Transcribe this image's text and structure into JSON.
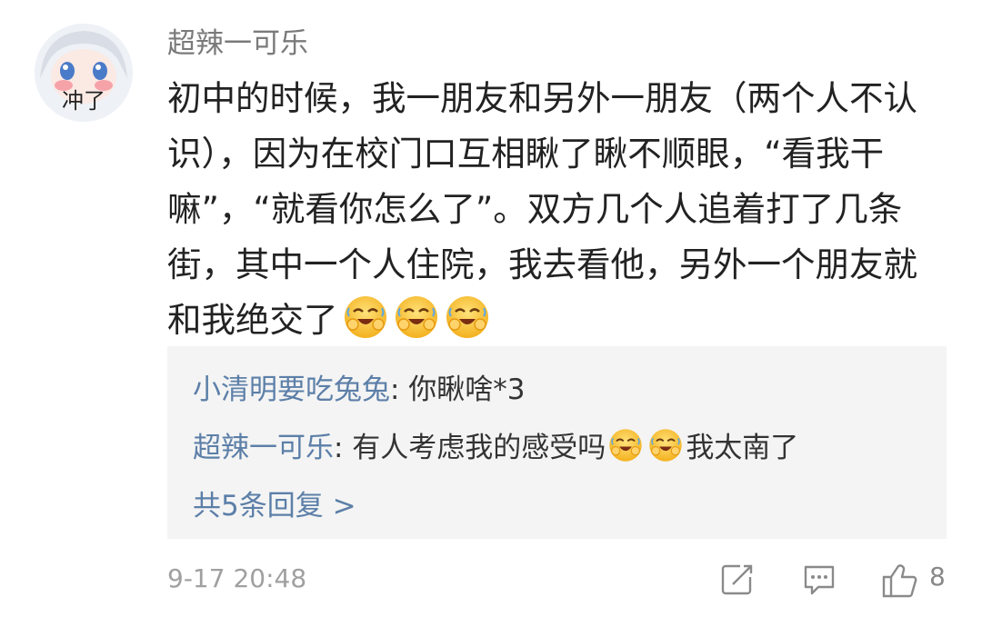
{
  "comment": {
    "avatar_text": "冲了",
    "username": "超辣一可乐",
    "lines": [
      "初中的时候，我一朋友和另外一朋友（两个人不认",
      "识），因为在校门口互相瞅了瞅不顺眼，“看我干",
      "嘛”，“就看你怎么了”。双方几个人追着打了几条",
      "街，其中一个人住院，我去看他，另外一个朋友就",
      "和我绝交了"
    ],
    "emoji": "laughing-crying-emoji",
    "timestamp": "9-17 20:48",
    "like_count": "8"
  },
  "replies": [
    {
      "name": "小清明要吃兔兔",
      "text": ": 你瞅啥*3"
    },
    {
      "name": "超辣一可乐",
      "text": ": 有人考虑我的感受吗",
      "tail": "我太南了"
    }
  ],
  "more_replies": "共5条回复 >",
  "colors": {
    "link": "#5c7fa8",
    "reply_bg": "#f4f4f4",
    "muted": "#a0a0a0"
  }
}
